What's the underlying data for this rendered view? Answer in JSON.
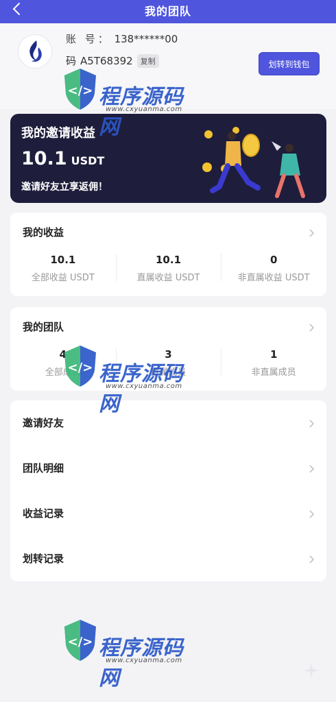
{
  "header": {
    "title": "我的团队"
  },
  "user": {
    "account_label": "账 号：",
    "account_value": "138******00",
    "invite_code_fragment": "码",
    "invite_code_value": "A5T68392",
    "copy_label": "复制",
    "transfer_button": "划转到钱包"
  },
  "banner": {
    "title": "我的邀请收益",
    "amount": "10.1",
    "unit": "USDT",
    "subtitle": "邀请好友立享返佣！"
  },
  "earnings": {
    "title": "我的收益",
    "stats": [
      {
        "value": "10.1",
        "label": "全部收益 USDT"
      },
      {
        "value": "10.1",
        "label": "直属收益 USDT"
      },
      {
        "value": "0",
        "label": "非直属收益 USDT"
      }
    ]
  },
  "team": {
    "title": "我的团队",
    "stats": [
      {
        "value": "4",
        "label": "全部成员"
      },
      {
        "value": "3",
        "label": "直属成员"
      },
      {
        "value": "1",
        "label": "非直属成员"
      }
    ]
  },
  "menu": [
    {
      "label": "邀请好友"
    },
    {
      "label": "团队明细"
    },
    {
      "label": "收益记录"
    },
    {
      "label": "划转记录"
    }
  ],
  "watermark": {
    "brand": "程序源码网",
    "url": "www.cxyuanma.com"
  },
  "colors": {
    "primary": "#4f55dc",
    "banner_bg": "#1e1d3b",
    "page_bg": "#f3f3f6"
  }
}
